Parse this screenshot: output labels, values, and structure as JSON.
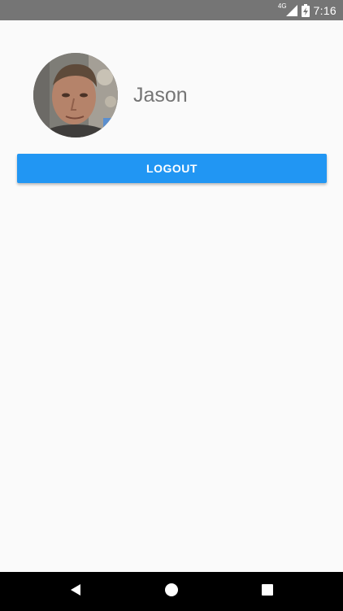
{
  "status_bar": {
    "network_type": "4G",
    "time": "7:16",
    "icons": [
      "signal-icon",
      "battery-charging-icon"
    ]
  },
  "profile": {
    "avatar": "profile-photo",
    "name": "Jason"
  },
  "actions": {
    "logout_label": "LOGOUT"
  },
  "nav_bar": {
    "icons": [
      "back-icon",
      "home-icon",
      "recents-icon"
    ]
  },
  "colors": {
    "status_bar": "#757575",
    "background": "#fafafa",
    "button": "#2196f3",
    "button_text": "#ffffff",
    "name_text": "#757575",
    "nav_bar": "#000000"
  }
}
